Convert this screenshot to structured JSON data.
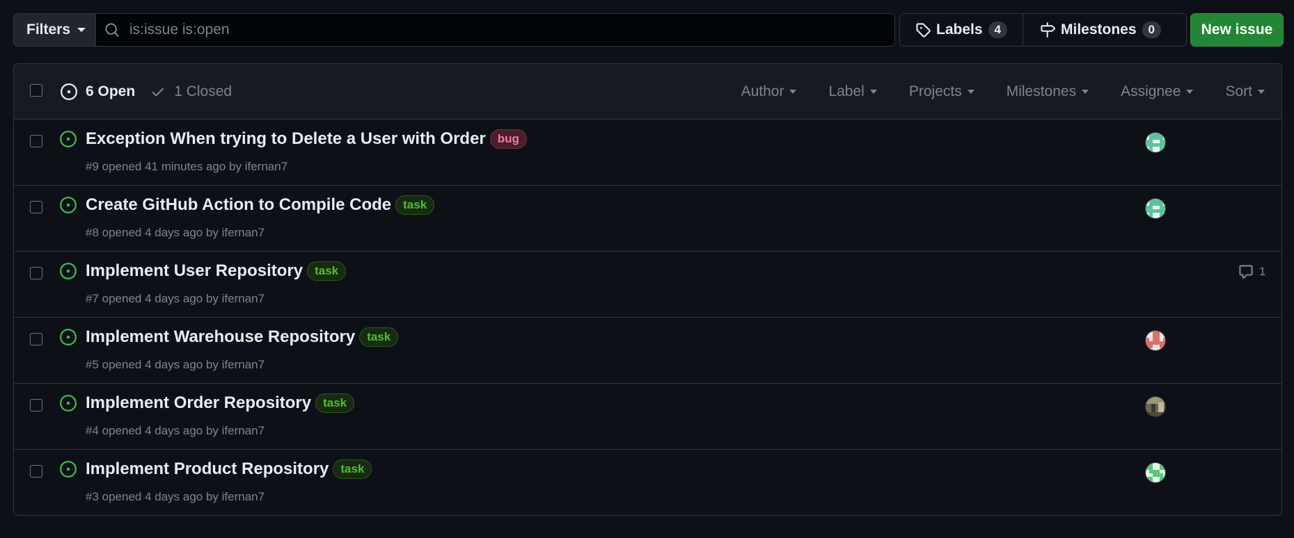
{
  "toolbar": {
    "filters_label": "Filters",
    "search_placeholder": "is:issue is:open",
    "labels_label": "Labels",
    "labels_count": "4",
    "milestones_label": "Milestones",
    "milestones_count": "0",
    "new_issue_label": "New issue"
  },
  "header": {
    "open_label": "6 Open",
    "closed_label": "1 Closed",
    "filters": [
      "Author",
      "Label",
      "Projects",
      "Milestones",
      "Assignee",
      "Sort"
    ]
  },
  "issues": [
    {
      "title": "Exception When trying to Delete a User with Order",
      "label": "bug",
      "meta": "#9 opened 41 minutes ago by ifernan7",
      "avatar": "teal"
    },
    {
      "title": "Create GitHub Action to Compile Code",
      "label": "task",
      "meta": "#8 opened 4 days ago by ifernan7",
      "avatar": "teal"
    },
    {
      "title": "Implement User Repository",
      "label": "task",
      "meta": "#7 opened 4 days ago by ifernan7",
      "comments": "1"
    },
    {
      "title": "Implement Warehouse Repository",
      "label": "task",
      "meta": "#5 opened 4 days ago by ifernan7",
      "avatar": "salmon"
    },
    {
      "title": "Implement Order Repository",
      "label": "task",
      "meta": "#4 opened 4 days ago by ifernan7",
      "avatar": "photo"
    },
    {
      "title": "Implement Product Repository",
      "label": "task",
      "meta": "#3 opened 4 days ago by ifernan7",
      "avatar": "green"
    }
  ],
  "colors": {
    "background": "#0d1117",
    "open_icon": "#3fb950",
    "primary_button": "#238636",
    "bug_label": "#f17ca0",
    "task_label": "#4cc227"
  }
}
